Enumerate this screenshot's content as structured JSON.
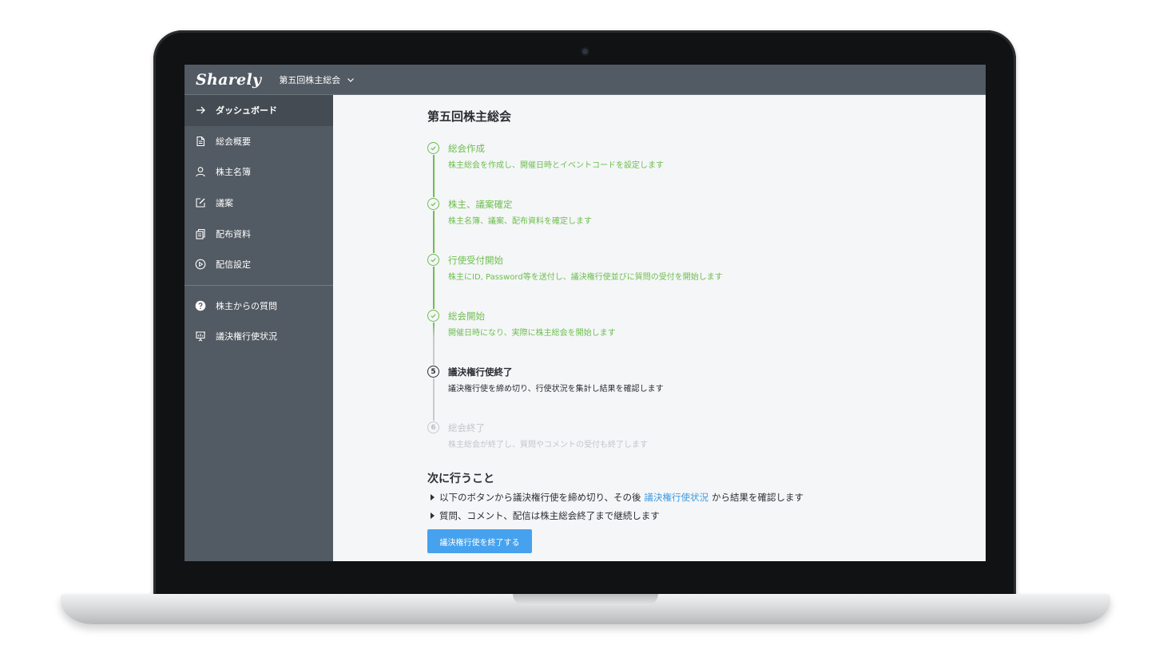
{
  "app": {
    "logo_text": "Sharely",
    "meeting_selector": "第五回株主総会"
  },
  "sidebar": {
    "items": [
      {
        "label": "ダッシュボード",
        "icon": "arrow-right-icon",
        "active": true
      },
      {
        "label": "総会概要",
        "icon": "document-icon"
      },
      {
        "label": "株主名簿",
        "icon": "user-icon"
      },
      {
        "label": "議案",
        "icon": "edit-icon"
      },
      {
        "label": "配布資料",
        "icon": "copy-icon"
      },
      {
        "label": "配信設定",
        "icon": "play-circle-icon"
      }
    ],
    "secondary_items": [
      {
        "label": "株主からの質問",
        "icon": "question-circle-icon"
      },
      {
        "label": "議決権行使状況",
        "icon": "presentation-icon"
      }
    ]
  },
  "main": {
    "page_title": "第五回株主総会",
    "steps": [
      {
        "number": "1",
        "status": "done",
        "title": "総会作成",
        "desc": "株主総会を作成し、開催日時とイベントコードを設定します"
      },
      {
        "number": "2",
        "status": "done",
        "title": "株主、議案確定",
        "desc": "株主名簿、議案、配布資料を確定します"
      },
      {
        "number": "3",
        "status": "done",
        "title": "行使受付開始",
        "desc": "株主にID, Password等を送付し、議決権行使並びに質問の受付を開始します"
      },
      {
        "number": "4",
        "status": "done",
        "title": "総会開始",
        "desc": "開催日時になり、実際に株主総会を開始します"
      },
      {
        "number": "5",
        "status": "current",
        "title": "議決権行使終了",
        "desc": "議決権行使を締め切り、行使状況を集計し結果を確認します"
      },
      {
        "number": "6",
        "status": "pending",
        "title": "総会終了",
        "desc": "株主総会が終了し、質問やコメントの受付も終了します"
      }
    ],
    "next_actions": {
      "title": "次に行うこと",
      "item1_before": "以下のボタンから議決権行使を締め切り、その後",
      "item1_link": "議決権行使状況",
      "item1_after": "から結果を確認します",
      "item2": "質問、コメント、配信は株主総会終了まで継続します"
    },
    "primary_button": "議決権行使を終了する"
  },
  "colors": {
    "topbar": "#525a63",
    "sidebar": "#525a63",
    "done_green": "#6cbf4e",
    "link_blue": "#3b9ae1",
    "button_blue": "#46a2ee"
  }
}
